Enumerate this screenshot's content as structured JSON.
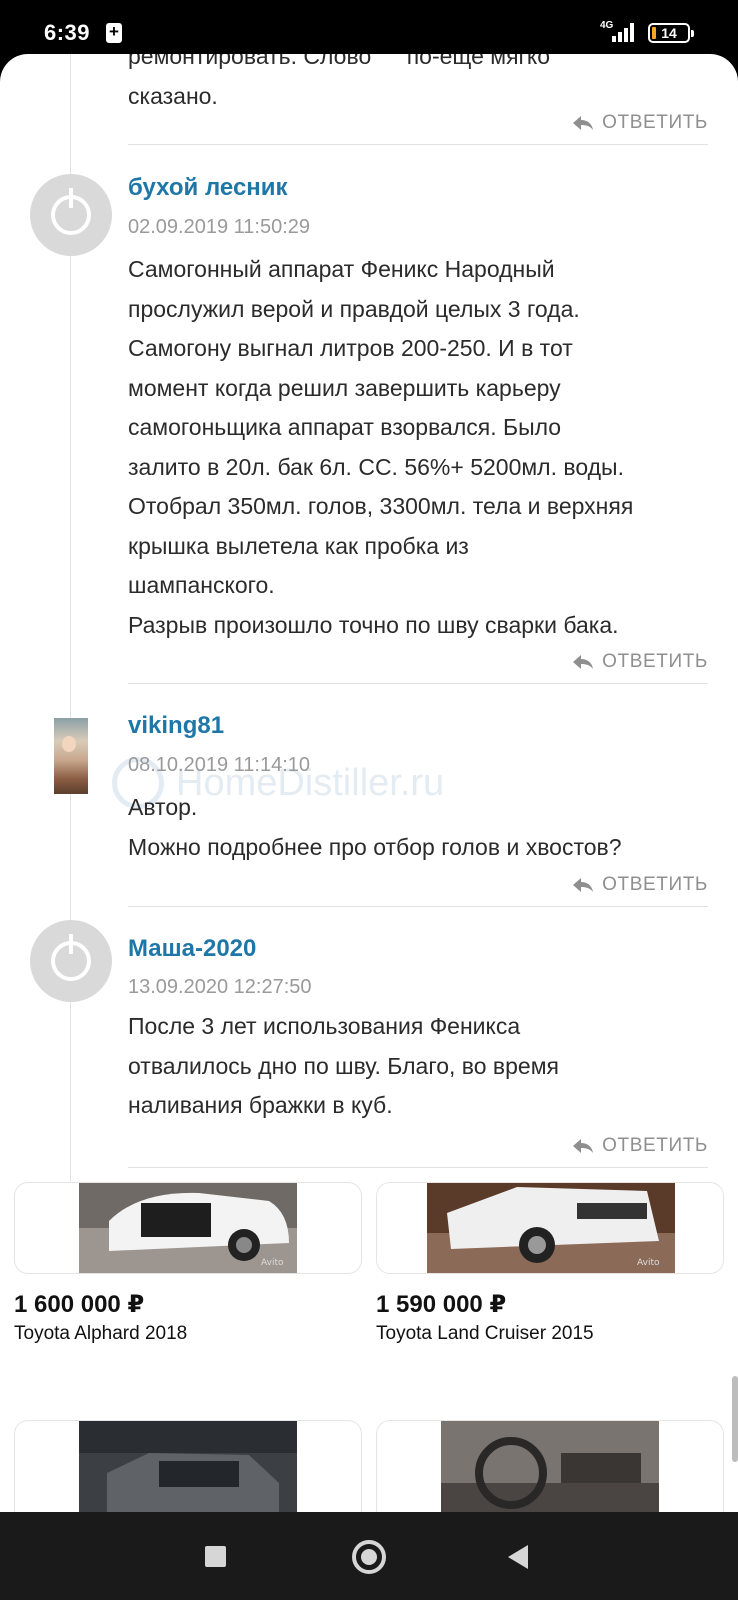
{
  "status_bar": {
    "time": "6:39",
    "network": "4G",
    "battery": "14"
  },
  "comments": [
    {
      "text_lines": [
        "ремонтировать. Слово \"   \" по-еще мягко",
        "сказано."
      ],
      "reply_label": "ОТВЕТИТЬ"
    },
    {
      "author": "бухой лесник",
      "date": "02.09.2019 11:50:29",
      "avatar": "default-avatar-icon",
      "text_lines": [
        "Самогонный аппарат Феникс Народный",
        "прослужил верой и правдой целых 3 года.",
        "Самогону выгнал литров 200-250. И в тот",
        "момент когда решил завершить карьеру",
        "самогоньщика аппарат взорвался. Было",
        "залито в 20л. бак 6л. СС. 56%+ 5200мл. воды.",
        "Отобрал 350мл. голов, 3300мл. тела и верхняя",
        "крышка вылетела как пробка из",
        "шампанского.",
        "Разрыв произошло точно по шву сварки бака."
      ],
      "reply_label": "ОТВЕТИТЬ"
    },
    {
      "author": "viking81",
      "date": "08.10.2019 11:14:10",
      "avatar": "user-photo",
      "text_lines": [
        "Автор.",
        "Можно подробнее про отбор голов и хвостов?"
      ],
      "reply_label": "ОТВЕТИТЬ"
    },
    {
      "author": "Маша-2020",
      "date": "13.09.2020 12:27:50",
      "avatar": "default-avatar-icon",
      "text_lines": [
        "После 3 лет использования Феникса",
        "отвалилось дно по шву. Благо, во время",
        "наливания бражки в куб."
      ],
      "reply_label": "ОТВЕТИТЬ"
    }
  ],
  "watermark": "HomeDistiller.ru",
  "ads": [
    {
      "price": "1 600 000 ₽",
      "title": "Toyota Alphard 2018",
      "badge": "Avito"
    },
    {
      "price": "1 590 000 ₽",
      "title": "Toyota Land Cruiser 2015",
      "badge": "Avito"
    }
  ],
  "colors": {
    "author": "#1f77a8",
    "date": "#9a9a9a",
    "text": "#2b2b2b",
    "reply": "#8f8f8f"
  }
}
